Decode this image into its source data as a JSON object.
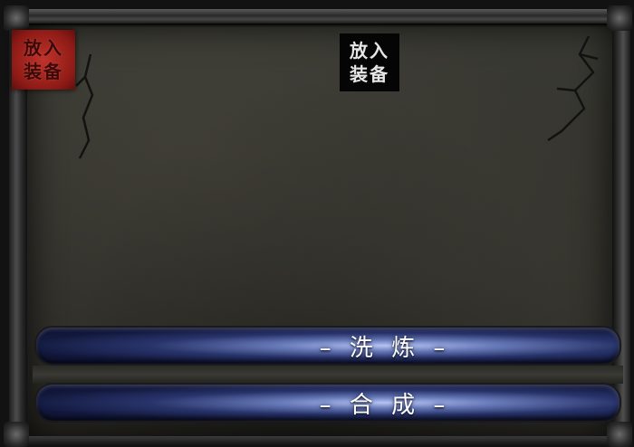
{
  "slots": {
    "left_label_line1": "放入",
    "left_label_line2": "装备",
    "center_label_line1": "放入",
    "center_label_line2": "装备"
  },
  "actions": {
    "wash_label": "– 洗 炼 –",
    "combine_label": "– 合 成 –"
  },
  "colors": {
    "slot_active": "#b02a24",
    "slot_empty": "#050505",
    "bar_glow": "#9aaaf0"
  }
}
